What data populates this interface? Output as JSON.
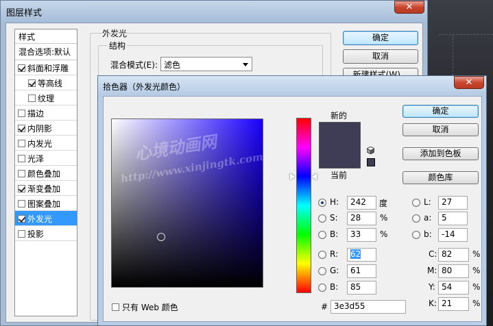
{
  "layer_style": {
    "title": "图层样式",
    "close": "✕",
    "styles_header": "样式",
    "blend_header": "混合选项:默认",
    "items": [
      {
        "label": "斜面和浮雕",
        "checked": true,
        "indent": false,
        "active": false
      },
      {
        "label": "等高线",
        "checked": true,
        "indent": true,
        "active": false
      },
      {
        "label": "纹理",
        "checked": false,
        "indent": true,
        "active": false
      },
      {
        "label": "描边",
        "checked": false,
        "indent": false,
        "active": false
      },
      {
        "label": "内阴影",
        "checked": true,
        "indent": false,
        "active": false
      },
      {
        "label": "内发光",
        "checked": false,
        "indent": false,
        "active": false
      },
      {
        "label": "光泽",
        "checked": false,
        "indent": false,
        "active": false
      },
      {
        "label": "颜色叠加",
        "checked": false,
        "indent": false,
        "active": false
      },
      {
        "label": "渐变叠加",
        "checked": true,
        "indent": false,
        "active": false
      },
      {
        "label": "图案叠加",
        "checked": false,
        "indent": false,
        "active": false
      },
      {
        "label": "外发光",
        "checked": true,
        "indent": false,
        "active": true
      },
      {
        "label": "投影",
        "checked": false,
        "indent": false,
        "active": false
      }
    ],
    "panel_title": "外发光",
    "group_title": "结构",
    "blend_mode_label": "混合模式(E):",
    "blend_mode_value": "滤色",
    "ok": "确定",
    "cancel": "取消",
    "new_style": "新建样式(W)..."
  },
  "color_picker": {
    "title": "拾色器（外发光颜色）",
    "close": "✕",
    "new_label": "新的",
    "current_label": "当前",
    "ok": "确定",
    "cancel": "取消",
    "add_swatch": "添加到色板",
    "libraries": "颜色库",
    "web_only": "只有 Web 颜色",
    "current_color": "#3e3d55",
    "hsb": {
      "h": "242",
      "h_unit": "度",
      "s": "28",
      "s_unit": "%",
      "b": "33",
      "b_unit": "%"
    },
    "rgb": {
      "r": "62",
      "g": "61",
      "b": "85"
    },
    "lab": {
      "l": "27",
      "a": "5",
      "b": "-14"
    },
    "cmyk": {
      "c": "82",
      "m": "80",
      "y": "54",
      "k": "21",
      "unit": "%"
    },
    "hex": "3e3d55",
    "labels": {
      "H": "H:",
      "S": "S:",
      "B": "B:",
      "R": "R:",
      "G": "G:",
      "Bb": "B:",
      "L": "L:",
      "a": "a:",
      "lb": "b:",
      "C": "C:",
      "M": "M:",
      "Y": "Y:",
      "K": "K:",
      "hash": "#"
    }
  },
  "watermark": {
    "line1": "心境动画网",
    "line2": "http://www.xinjingtk.com"
  }
}
